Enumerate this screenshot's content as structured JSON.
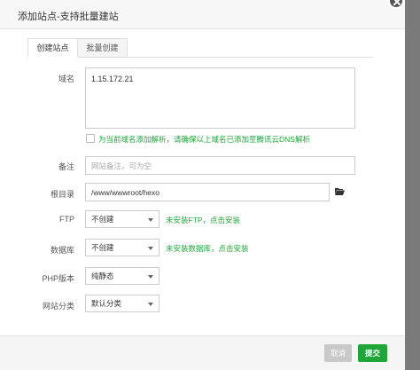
{
  "modal": {
    "title": "添加站点-支持批量建站"
  },
  "tabs": [
    {
      "label": "创建站点",
      "active": true
    },
    {
      "label": "批量创建",
      "active": false
    }
  ],
  "form": {
    "domain": {
      "label": "域名",
      "value": "1.15.172.21"
    },
    "dns_checkbox": {
      "checked": false,
      "label": "为当前域名添加解析，请确保以上域名已添加至腾讯云DNS解析"
    },
    "remark": {
      "label": "备注",
      "placeholder": "网站备注，可为空"
    },
    "root": {
      "label": "根目录",
      "value": "/www/wwwroot/hexo"
    },
    "ftp": {
      "label": "FTP",
      "selected": "不创建",
      "hint": "未安装FTP，点击安装"
    },
    "database": {
      "label": "数据库",
      "selected": "不创建",
      "hint": "未安装数据库，点击安装"
    },
    "php": {
      "label": "PHP版本",
      "selected": "纯静态"
    },
    "category": {
      "label": "网站分类",
      "selected": "默认分类"
    }
  },
  "footer": {
    "cancel_label": "取消",
    "submit_label": "提交"
  },
  "colors": {
    "accent": "#20a53a",
    "cancel": "#c9c9c9"
  }
}
